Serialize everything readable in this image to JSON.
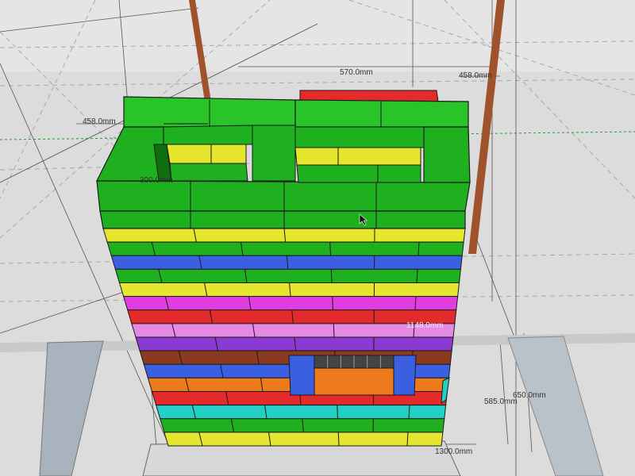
{
  "viewport": {
    "background": "#dcdcdc",
    "grid_color": "#b8b8b8",
    "sheen_color": "#ffffff"
  },
  "dimensions": {
    "top_width": "570.0mm",
    "top_right": "458.0mm",
    "left_side": "458.0mm",
    "inner_small": "300.0mm",
    "right_mid": "1148.0mm",
    "height_a": "585.0mm",
    "height_b": "650.0mm",
    "base_width": "1300.0mm"
  },
  "colors": {
    "green": "#1fb01f",
    "green_top": "#28c428",
    "yellow": "#e6e62e",
    "blue": "#3a5fe0",
    "magenta": "#e03ee0",
    "red": "#e42a2a",
    "pink": "#e48ae4",
    "purple": "#8a3ad0",
    "brown": "#8a3a1e",
    "orange": "#ee7a1e",
    "cyan": "#22d0c8",
    "edge": "#1a1a1a",
    "pole": "#a0522d",
    "dark_block": "#444444"
  },
  "courses": [
    {
      "color": "yellow"
    },
    {
      "color": "green"
    },
    {
      "color": "blue"
    },
    {
      "color": "green"
    },
    {
      "color": "yellow"
    },
    {
      "color": "magenta"
    },
    {
      "color": "red"
    },
    {
      "color": "pink"
    },
    {
      "color": "purple"
    },
    {
      "color": "brown"
    },
    {
      "color": "blue"
    },
    {
      "color": "orange"
    },
    {
      "color": "red"
    },
    {
      "color": "cyan"
    },
    {
      "color": "green"
    },
    {
      "color": "yellow"
    }
  ]
}
